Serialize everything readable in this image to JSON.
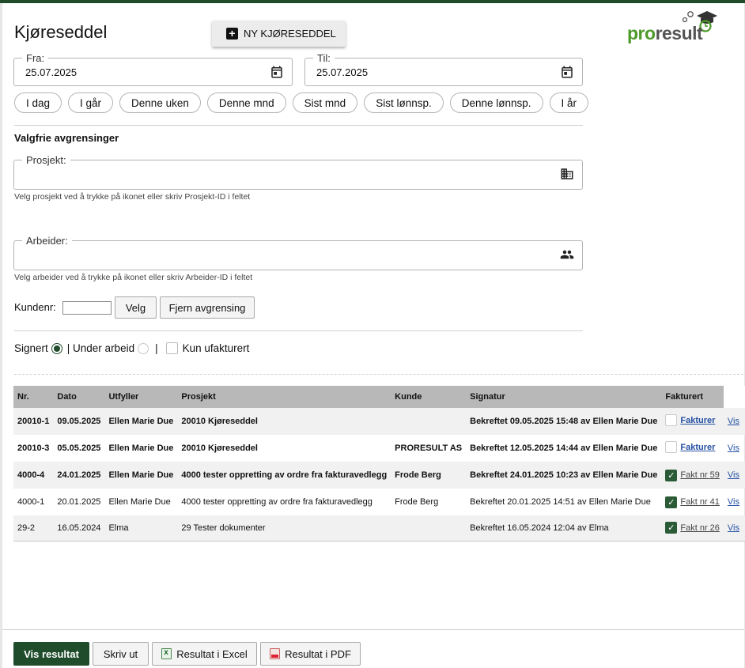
{
  "header": {
    "title": "Kjøreseddel",
    "new_button_label": "NY KJØRESEDDEL",
    "logo_pro": "pro",
    "logo_result": "result"
  },
  "dates": {
    "from_label": "Fra:",
    "from_value": "25.07.2025",
    "to_label": "Til:",
    "to_value": "25.07.2025"
  },
  "quick_ranges": [
    "I dag",
    "I går",
    "Denne uken",
    "Denne mnd",
    "Sist mnd",
    "Sist lønnsp.",
    "Denne lønnsp.",
    "I år"
  ],
  "optional": {
    "section_title": "Valgfrie avgrensinger",
    "project_label": "Prosjekt:",
    "project_value": "",
    "project_hint": "Velg prosjekt ved å trykke på ikonet eller skriv Prosjekt-ID i feltet",
    "worker_label": "Arbeider:",
    "worker_value": "",
    "worker_hint": "Velg arbeider ved å trykke på ikonet eller skriv Arbeider-ID i feltet",
    "customer_label": "Kundenr:",
    "customer_value": "",
    "choose_button": "Velg",
    "remove_button": "Fjern avgrensing"
  },
  "status_filter": {
    "signed_label": "Signert",
    "signed_selected": true,
    "in_progress_label": "| Under arbeid",
    "in_progress_selected": false,
    "separator": "|",
    "uninvoiced_label": "Kun ufakturert",
    "uninvoiced_checked": false
  },
  "table": {
    "headers": [
      "Nr.",
      "Dato",
      "Utfyller",
      "Prosjekt",
      "Kunde",
      "Signatur",
      "Fakturert"
    ],
    "rows": [
      {
        "nr": "20010-1",
        "dato": "09.05.2025",
        "utfyller": "Ellen Marie Due",
        "prosjekt": "20010 Kjøreseddel",
        "kunde": "",
        "signatur": "Bekreftet 09.05.2025 15:48 av Ellen Marie Due",
        "invoiced": false,
        "invoice_label": "Fakturer",
        "view": "Vis",
        "bold": true
      },
      {
        "nr": "20010-3",
        "dato": "05.05.2025",
        "utfyller": "Ellen Marie Due",
        "prosjekt": "20010 Kjøreseddel",
        "kunde": "PRORESULT AS",
        "signatur": "Bekreftet 12.05.2025 14:44 av Ellen Marie Due",
        "invoiced": false,
        "invoice_label": "Fakturer",
        "view": "Vis",
        "bold": true
      },
      {
        "nr": "4000-4",
        "dato": "24.01.2025",
        "utfyller": "Ellen Marie Due",
        "prosjekt": "4000 tester oppretting av ordre fra fakturavedlegg",
        "kunde": "Frode Berg",
        "signatur": "Bekreftet 24.01.2025 10:23 av Ellen Marie Due",
        "invoiced": true,
        "invoice_label": "Fakt nr 59",
        "view": "Vis",
        "bold": true
      },
      {
        "nr": "4000-1",
        "dato": "20.01.2025",
        "utfyller": "Ellen Marie Due",
        "prosjekt": "4000 tester oppretting av ordre fra fakturavedlegg",
        "kunde": "Frode Berg",
        "signatur": "Bekreftet 20.01.2025 14:51 av Ellen Marie Due",
        "invoiced": true,
        "invoice_label": "Fakt nr 41",
        "view": "Vis",
        "bold": false
      },
      {
        "nr": "29-2",
        "dato": "16.05.2024",
        "utfyller": "Elma",
        "prosjekt": "29 Tester dokumenter",
        "kunde": "",
        "signatur": "Bekreftet 16.05.2024 12:04 av Elma",
        "invoiced": true,
        "invoice_label": "Fakt nr 26",
        "view": "Vis",
        "bold": false
      }
    ]
  },
  "footer": {
    "show_results": "Vis resultat",
    "print": "Skriv ut",
    "excel": "Resultat i Excel",
    "pdf": "Resultat i PDF"
  },
  "colors": {
    "brand_green": "#1f4d2c",
    "logo_green": "#4c9a2a",
    "header_gray": "#b8b8b8",
    "delete_orange": "#e05a2b",
    "link_blue": "#2451a3"
  }
}
